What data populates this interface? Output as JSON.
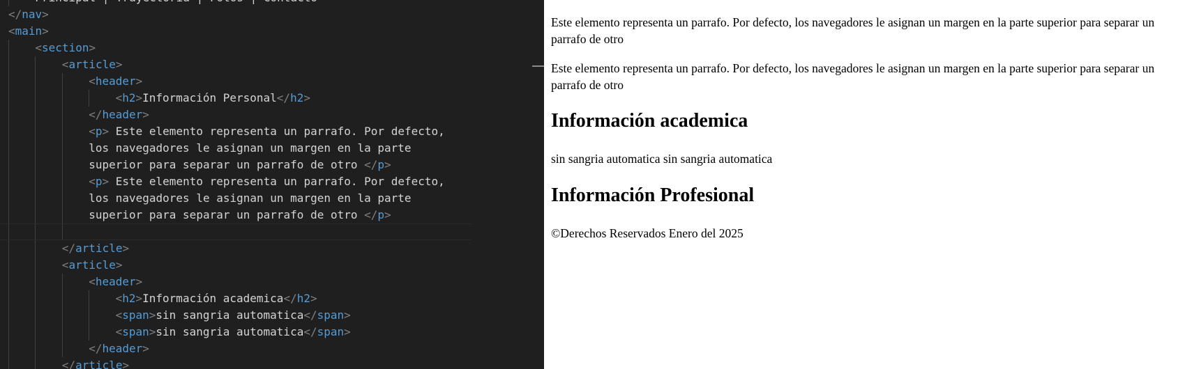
{
  "editor": {
    "lines": [
      {
        "indent": 1,
        "tokens": [
          {
            "t": "txt",
            "v": "Principal | Trayectoria | Fotos | Contacto"
          }
        ]
      },
      {
        "indent": 0,
        "tokens": [
          {
            "t": "br",
            "v": "</"
          },
          {
            "t": "tag",
            "v": "nav"
          },
          {
            "t": "br",
            "v": ">"
          }
        ]
      },
      {
        "indent": 0,
        "tokens": [
          {
            "t": "br",
            "v": "<"
          },
          {
            "t": "tag",
            "v": "main"
          },
          {
            "t": "br",
            "v": ">"
          }
        ]
      },
      {
        "indent": 1,
        "tokens": [
          {
            "t": "br",
            "v": "<"
          },
          {
            "t": "tag",
            "v": "section"
          },
          {
            "t": "br",
            "v": ">"
          }
        ]
      },
      {
        "indent": 2,
        "tokens": [
          {
            "t": "br",
            "v": "<"
          },
          {
            "t": "tag",
            "v": "article"
          },
          {
            "t": "br",
            "v": ">"
          }
        ]
      },
      {
        "indent": 3,
        "tokens": [
          {
            "t": "br",
            "v": "<"
          },
          {
            "t": "tag",
            "v": "header"
          },
          {
            "t": "br",
            "v": ">"
          }
        ]
      },
      {
        "indent": 4,
        "tokens": [
          {
            "t": "br",
            "v": "<"
          },
          {
            "t": "tag",
            "v": "h2"
          },
          {
            "t": "br",
            "v": ">"
          },
          {
            "t": "txt",
            "v": "Información Personal"
          },
          {
            "t": "br",
            "v": "</"
          },
          {
            "t": "tag",
            "v": "h2"
          },
          {
            "t": "br",
            "v": ">"
          }
        ]
      },
      {
        "indent": 3,
        "tokens": [
          {
            "t": "br",
            "v": "</"
          },
          {
            "t": "tag",
            "v": "header"
          },
          {
            "t": "br",
            "v": ">"
          }
        ]
      },
      {
        "indent": 3,
        "tokens": [
          {
            "t": "br",
            "v": "<"
          },
          {
            "t": "tag",
            "v": "p"
          },
          {
            "t": "br",
            "v": ">"
          },
          {
            "t": "txt",
            "v": " Este elemento representa un parrafo. Por defecto,"
          }
        ]
      },
      {
        "indent": 3,
        "tokens": [
          {
            "t": "txt",
            "v": "los navegadores le asignan un margen en la parte"
          }
        ]
      },
      {
        "indent": 3,
        "tokens": [
          {
            "t": "txt",
            "v": "superior para separar un parrafo de otro "
          },
          {
            "t": "br",
            "v": "</"
          },
          {
            "t": "tag",
            "v": "p"
          },
          {
            "t": "br",
            "v": ">"
          }
        ]
      },
      {
        "indent": 3,
        "tokens": [
          {
            "t": "br",
            "v": "<"
          },
          {
            "t": "tag",
            "v": "p"
          },
          {
            "t": "br",
            "v": ">"
          },
          {
            "t": "txt",
            "v": " Este elemento representa un parrafo. Por defecto,"
          }
        ]
      },
      {
        "indent": 3,
        "tokens": [
          {
            "t": "txt",
            "v": "los navegadores le asignan un margen en la parte"
          }
        ]
      },
      {
        "indent": 3,
        "tokens": [
          {
            "t": "txt",
            "v": "superior para separar un parrafo de otro "
          },
          {
            "t": "br",
            "v": "</"
          },
          {
            "t": "tag",
            "v": "p"
          },
          {
            "t": "br",
            "v": ">"
          }
        ]
      },
      {
        "indent": 3,
        "tokens": [],
        "current": true
      },
      {
        "indent": 2,
        "tokens": [
          {
            "t": "br",
            "v": "</"
          },
          {
            "t": "tag",
            "v": "article"
          },
          {
            "t": "br",
            "v": ">"
          }
        ]
      },
      {
        "indent": 2,
        "tokens": [
          {
            "t": "br",
            "v": "<"
          },
          {
            "t": "tag",
            "v": "article"
          },
          {
            "t": "br",
            "v": ">"
          }
        ]
      },
      {
        "indent": 3,
        "tokens": [
          {
            "t": "br",
            "v": "<"
          },
          {
            "t": "tag",
            "v": "header"
          },
          {
            "t": "br",
            "v": ">"
          }
        ]
      },
      {
        "indent": 4,
        "tokens": [
          {
            "t": "br",
            "v": "<"
          },
          {
            "t": "tag",
            "v": "h2"
          },
          {
            "t": "br",
            "v": ">"
          },
          {
            "t": "txt",
            "v": "Información academica"
          },
          {
            "t": "br",
            "v": "</"
          },
          {
            "t": "tag",
            "v": "h2"
          },
          {
            "t": "br",
            "v": ">"
          }
        ]
      },
      {
        "indent": 4,
        "tokens": [
          {
            "t": "br",
            "v": "<"
          },
          {
            "t": "tag",
            "v": "span"
          },
          {
            "t": "br",
            "v": ">"
          },
          {
            "t": "txt",
            "v": "sin sangria automatica"
          },
          {
            "t": "br",
            "v": "</"
          },
          {
            "t": "tag",
            "v": "span"
          },
          {
            "t": "br",
            "v": ">"
          }
        ]
      },
      {
        "indent": 4,
        "tokens": [
          {
            "t": "br",
            "v": "<"
          },
          {
            "t": "tag",
            "v": "span"
          },
          {
            "t": "br",
            "v": ">"
          },
          {
            "t": "txt",
            "v": "sin sangria automatica"
          },
          {
            "t": "br",
            "v": "</"
          },
          {
            "t": "tag",
            "v": "span"
          },
          {
            "t": "br",
            "v": ">"
          }
        ]
      },
      {
        "indent": 3,
        "tokens": [
          {
            "t": "br",
            "v": "</"
          },
          {
            "t": "tag",
            "v": "header"
          },
          {
            "t": "br",
            "v": ">"
          }
        ]
      },
      {
        "indent": 2,
        "tokens": [
          {
            "t": "br",
            "v": "</"
          },
          {
            "t": "tag",
            "v": "article"
          },
          {
            "t": "br",
            "v": ">"
          }
        ]
      }
    ]
  },
  "preview": {
    "paragraph_1": "Este elemento representa un parrafo. Por defecto, los navegadores le asignan un margen en la parte superior para separar un parrafo de otro",
    "paragraph_2": "Este elemento representa un parrafo. Por defecto, los navegadores le asignan un margen en la parte superior para separar un parrafo de otro",
    "heading_academica": "Información academica",
    "span_text": "sin sangria automatica sin sangria automatica",
    "heading_profesional": "Información Profesional",
    "footer_text": "©Derechos Reservados Enero del 2025"
  },
  "colors": {
    "editor_bg": "#1f1f1f",
    "tag": "#569cd6",
    "bracket": "#808080",
    "text": "#d4d4d4"
  }
}
